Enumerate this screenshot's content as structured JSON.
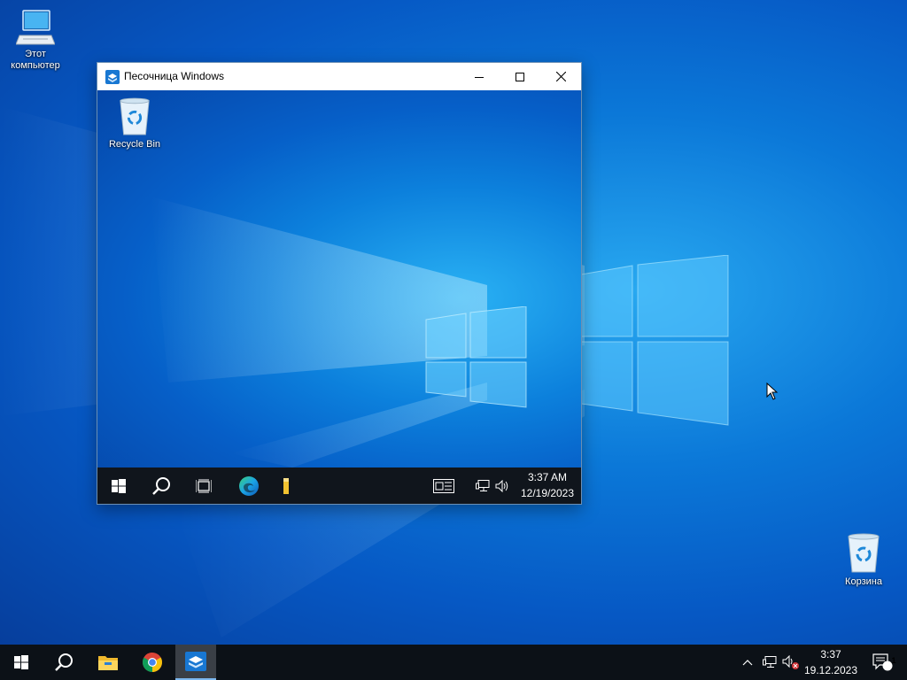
{
  "desktop": {
    "icons": [
      {
        "label_line1": "Этот",
        "label_line2": "компьютер"
      },
      {
        "label": "Корзина"
      }
    ]
  },
  "sandbox_window": {
    "title": "Песочница Windows",
    "inner_desktop": {
      "recycle_bin_label": "Recycle Bin"
    },
    "inner_taskbar": {
      "time": "3:37 AM",
      "date": "12/19/2023"
    }
  },
  "taskbar": {
    "time": "3:37",
    "date": "19.12.2023",
    "notification_count": "1",
    "pinned": [
      "start-icon",
      "search-icon",
      "file-explorer-icon",
      "chrome-icon",
      "windows-sandbox-icon"
    ]
  },
  "colors": {
    "desktop_blue": "#0b78d8",
    "taskbar": "#0c1117",
    "active_indicator": "#7cb7ee"
  }
}
